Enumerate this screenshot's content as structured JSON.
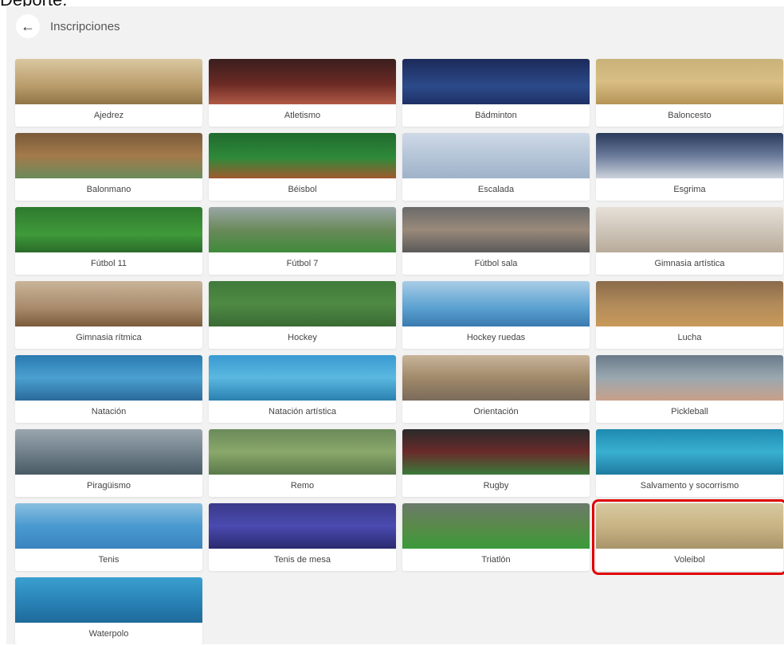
{
  "top_title": "Deporte:",
  "header": {
    "title": "Inscripciones"
  },
  "sports": [
    {
      "label": "Ajedrez",
      "bg": "linear-gradient(180deg,#d9c7a1 0%,#b99c6a 60%,#8f7448 100%)"
    },
    {
      "label": "Atletismo",
      "bg": "linear-gradient(180deg,#3a1e1e 0%,#6b2a24 55%,#b05a45 100%)"
    },
    {
      "label": "Bádminton",
      "bg": "linear-gradient(180deg,#1b2a5a 0%,#2c4a8a 60%,#1e3066 100%)"
    },
    {
      "label": "Baloncesto",
      "bg": "linear-gradient(180deg,#c9b27a 0%,#d8be84 50%,#b69456 100%)"
    },
    {
      "label": "Balonmano",
      "bg": "linear-gradient(180deg,#7a5a3a 0%,#a47a4a 50%,#6a8a5a 100%)"
    },
    {
      "label": "Béisbol",
      "bg": "linear-gradient(180deg,#1f6a2c 0%,#2f8a3a 55%,#a0582e 100%)"
    },
    {
      "label": "Escalada",
      "bg": "linear-gradient(180deg,#cfd9e6 0%,#b5c6d8 50%,#9fb2c8 100%)"
    },
    {
      "label": "Esgrima",
      "bg": "linear-gradient(180deg,#2a3a5a 0%,#6a7a9a 50%,#cdd3dc 100%)"
    },
    {
      "label": "Fútbol 11",
      "bg": "linear-gradient(180deg,#2e7a2e 0%,#3f9a3a 60%,#2a6a2a 100%)"
    },
    {
      "label": "Fútbol 7",
      "bg": "linear-gradient(180deg,#9aa6a6 0%,#6a8a5a 50%,#3f8a3a 100%)"
    },
    {
      "label": "Fútbol sala",
      "bg": "linear-gradient(180deg,#6a6a6a 0%,#9a8a7a 50%,#5a5a5a 100%)"
    },
    {
      "label": "Gimnasia artística",
      "bg": "linear-gradient(180deg,#e6e0d8 0%,#cfc6ba 50%,#b8ab9a 100%)"
    },
    {
      "label": "Gimnasia rítmica",
      "bg": "linear-gradient(180deg,#c9b49a 0%,#a88a6a 60%,#7a5a3a 100%)"
    },
    {
      "label": "Hockey",
      "bg": "linear-gradient(180deg,#3f7a3a 0%,#4f8a44 50%,#3a6a34 100%)"
    },
    {
      "label": "Hockey ruedas",
      "bg": "linear-gradient(180deg,#a8cde6 0%,#5aa0d0 60%,#3a7ab0 100%)"
    },
    {
      "label": "Lucha",
      "bg": "linear-gradient(180deg,#8a6a4a 0%,#b08a5a 50%,#c99a5a 100%)"
    },
    {
      "label": "Natación",
      "bg": "linear-gradient(180deg,#2a7ab0 0%,#4aa0d0 50%,#2a6a9a 100%)"
    },
    {
      "label": "Natación artística",
      "bg": "linear-gradient(180deg,#3a9ad0 0%,#5ab8e0 50%,#2a80b0 100%)"
    },
    {
      "label": "Orientación",
      "bg": "linear-gradient(180deg,#c8b49a 0%,#a08a6a 50%,#7a6a5a 100%)"
    },
    {
      "label": "Pickleball",
      "bg": "linear-gradient(180deg,#6a7a8a 0%,#9aa8b0 50%,#c9a08a 100%)"
    },
    {
      "label": "Piragüismo",
      "bg": "linear-gradient(180deg,#9aa6b0 0%,#6a7a84 60%,#4a5a64 100%)"
    },
    {
      "label": "Remo",
      "bg": "linear-gradient(180deg,#6a8a5a 0%,#8aa86a 50%,#5a7a4a 100%)"
    },
    {
      "label": "Rugby",
      "bg": "linear-gradient(180deg,#2a2a2a 0%,#6a2a2a 50%,#3a7a3a 100%)"
    },
    {
      "label": "Salvamento y socorrismo",
      "bg": "linear-gradient(180deg,#1e8ab0 0%,#3ab0d0 50%,#1e7aa0 100%)"
    },
    {
      "label": "Tenis",
      "bg": "linear-gradient(180deg,#8ac0e0 0%,#4a9ad0 50%,#3a84c0 100%)"
    },
    {
      "label": "Tenis de mesa",
      "bg": "linear-gradient(180deg,#3a3a8a 0%,#4a4ab0 50%,#2a2a70 100%)"
    },
    {
      "label": "Triatlón",
      "bg": "linear-gradient(180deg,#6a7a6a 0%,#5a8a4a 50%,#3a9a3a 100%)"
    },
    {
      "label": "Voleibol",
      "bg": "linear-gradient(180deg,#d8c9a0 0%,#c8b484 50%,#a8946a 100%)",
      "selected": true
    },
    {
      "label": "Waterpolo",
      "bg": "linear-gradient(180deg,#3aa0d0 0%,#2a84b8 50%,#1e6a9a 100%)"
    }
  ],
  "colors": {
    "selection": "#e00000",
    "panel": "#f2f2f2"
  },
  "icons": {
    "back": "arrow-left-icon"
  }
}
